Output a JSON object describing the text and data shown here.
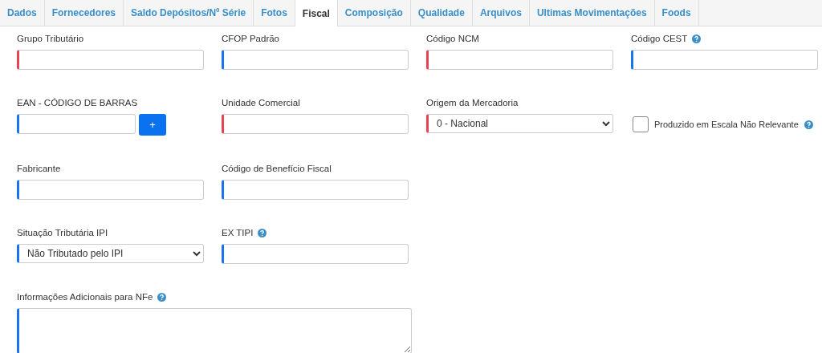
{
  "tabs": [
    {
      "label": "Dados",
      "selected": false
    },
    {
      "label": "Fornecedores",
      "selected": false
    },
    {
      "label": "Saldo Depósitos/Nº Série",
      "selected": false
    },
    {
      "label": "Fotos",
      "selected": false
    },
    {
      "label": "Fiscal",
      "selected": true
    },
    {
      "label": "Composição",
      "selected": false
    },
    {
      "label": "Qualidade",
      "selected": false
    },
    {
      "label": "Arquivos",
      "selected": false
    },
    {
      "label": "Ultimas Movimentações",
      "selected": false
    },
    {
      "label": "Foods",
      "selected": false
    }
  ],
  "rows": [
    [
      {
        "kind": "text",
        "label": "Grupo Tributário",
        "required": true
      },
      {
        "kind": "text",
        "label": "CFOP Padrão",
        "required": false
      },
      {
        "kind": "text",
        "label": "Código NCM",
        "required": true
      },
      {
        "kind": "text",
        "label": "Código CEST",
        "required": false,
        "help": true
      }
    ],
    [
      {
        "kind": "text-button",
        "label": "EAN - CÓDIGO DE BARRAS",
        "required": false,
        "button": "+"
      },
      {
        "kind": "text",
        "label": "Unidade Comercial",
        "required": true
      },
      {
        "kind": "select",
        "label": "Origem da Mercadoria",
        "required": true,
        "value": "0 - Nacional"
      },
      {
        "kind": "checkbox",
        "label": "Produzido em Escala Não Relevante",
        "checked": false,
        "help": true
      }
    ],
    [
      {
        "kind": "text",
        "label": "Fabricante",
        "required": false
      },
      {
        "kind": "text",
        "label": "Código de Benefício Fiscal",
        "required": false
      }
    ],
    [
      {
        "kind": "select",
        "label": "Situação Tributária IPI",
        "required": false,
        "value": "Não Tributado pelo IPI"
      },
      {
        "kind": "text",
        "label": "EX TIPI",
        "required": false,
        "help": true
      }
    ],
    [
      {
        "kind": "textarea",
        "label": "Informações Adicionais para NFe",
        "required": false,
        "help": true
      }
    ]
  ]
}
